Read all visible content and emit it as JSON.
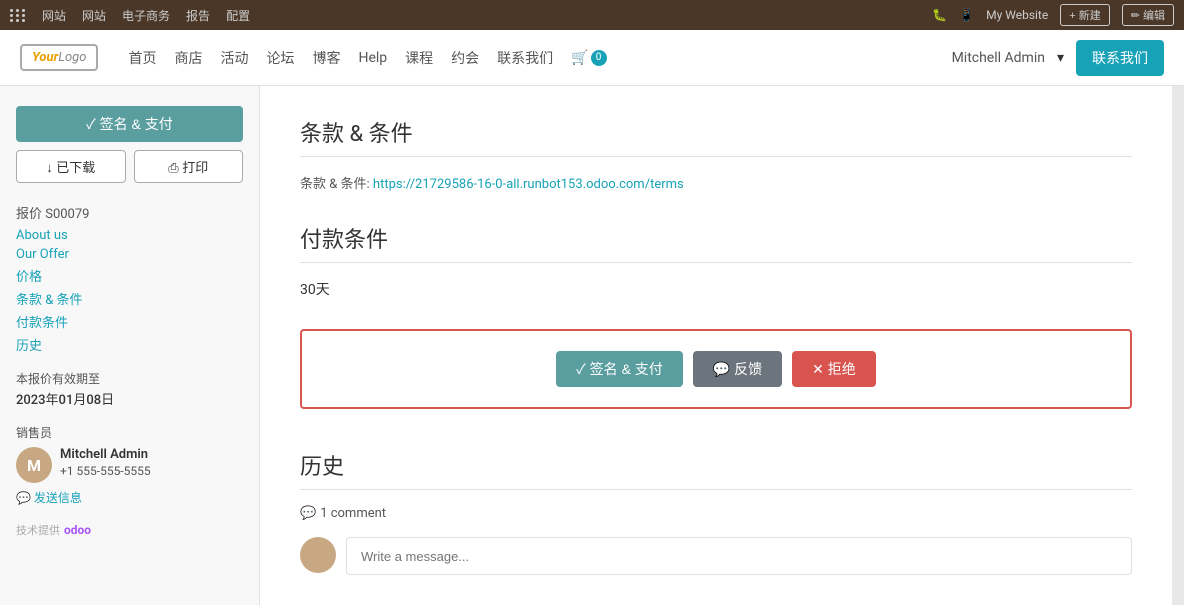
{
  "adminBar": {
    "gridIcon": "grid-icon",
    "items": [
      "网站",
      "网站",
      "电子商务",
      "报告",
      "配置"
    ],
    "rightItems": {
      "bugIcon": "🐛",
      "mobileIcon": "📱",
      "myWebsite": "My Website",
      "newBtn": "+ 新建",
      "editBtn": "✏ 编辑"
    }
  },
  "navbar": {
    "logo": "YourLogo",
    "links": [
      "首页",
      "商店",
      "活动",
      "论坛",
      "博客",
      "Help",
      "课程",
      "约会",
      "联系我们"
    ],
    "cartCount": "0",
    "user": "Mitchell Admin",
    "contactBtn": "联系我们"
  },
  "sidebar": {
    "signPayBtn": "✓ 签名 & 支付",
    "downloadBtn": "↓ 已下载",
    "printBtn": "⎙ 打印",
    "quoteId": "报价 S00079",
    "links": [
      "About us",
      "Our Offer",
      "价格",
      "条款 & 条件",
      "付款条件",
      "历史"
    ],
    "validityLabel": "本报价有效期至",
    "validityDate": "2023年01月08日",
    "salespersonLabel": "销售员",
    "salespersonName": "Mitchell Admin",
    "salespersonPhone": "+1 555-555-5555",
    "sendMsgLabel": "💬 发送信息",
    "poweredBy": "技术提供",
    "odoo": "odoo"
  },
  "content": {
    "termsTitle": "条款 & 条件",
    "termsLabel": "条款 & 条件:",
    "termsLink": "https://21729586-16-0-all.runbot153.odoo.com/terms",
    "paymentTitle": "付款条件",
    "paymentDays": "30天",
    "actionBtns": {
      "sign": "✓ 签名 & 支付",
      "feedback": "💬 反馈",
      "reject": "✕ 拒绝"
    },
    "historyTitle": "历史",
    "commentCount": "1 comment",
    "messagePlaceholder": "Write a message..."
  }
}
